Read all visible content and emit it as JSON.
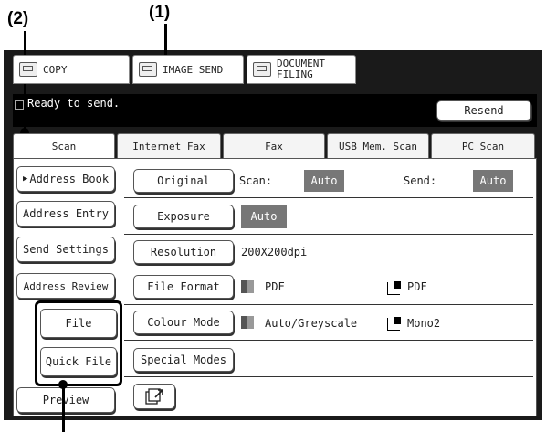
{
  "callouts": {
    "c1": "(1)",
    "c2": "(2)"
  },
  "top_tabs": {
    "copy": "COPY",
    "image_send": "IMAGE SEND",
    "document_filing_1": "DOCUMENT",
    "document_filing_2": "FILING"
  },
  "status": {
    "message": "Ready to send.",
    "resend": "Resend"
  },
  "mode_tabs": [
    "Scan",
    "Internet Fax",
    "Fax",
    "USB Mem. Scan",
    "PC Scan"
  ],
  "left_menu": {
    "address_book": "Address Book",
    "address_entry": "Address Entry",
    "send_settings": "Send Settings",
    "address_review": "Address Review",
    "file": "File",
    "quick_file": "Quick File",
    "preview": "Preview"
  },
  "settings": {
    "original_btn": "Original",
    "scan_label": "Scan:",
    "scan_value": "Auto",
    "send_label": "Send:",
    "send_value": "Auto",
    "exposure_btn": "Exposure",
    "exposure_value": "Auto",
    "resolution_btn": "Resolution",
    "resolution_value": "200X200dpi",
    "file_format_btn": "File Format",
    "file_format_color": "PDF",
    "file_format_mono": "PDF",
    "colour_mode_btn": "Colour Mode",
    "colour_mode_color": "Auto/Greyscale",
    "colour_mode_mono": "Mono2",
    "special_modes_btn": "Special Modes"
  },
  "icons": {
    "flag": "triangle-right-icon",
    "send_options": "document-arrow-icon"
  }
}
